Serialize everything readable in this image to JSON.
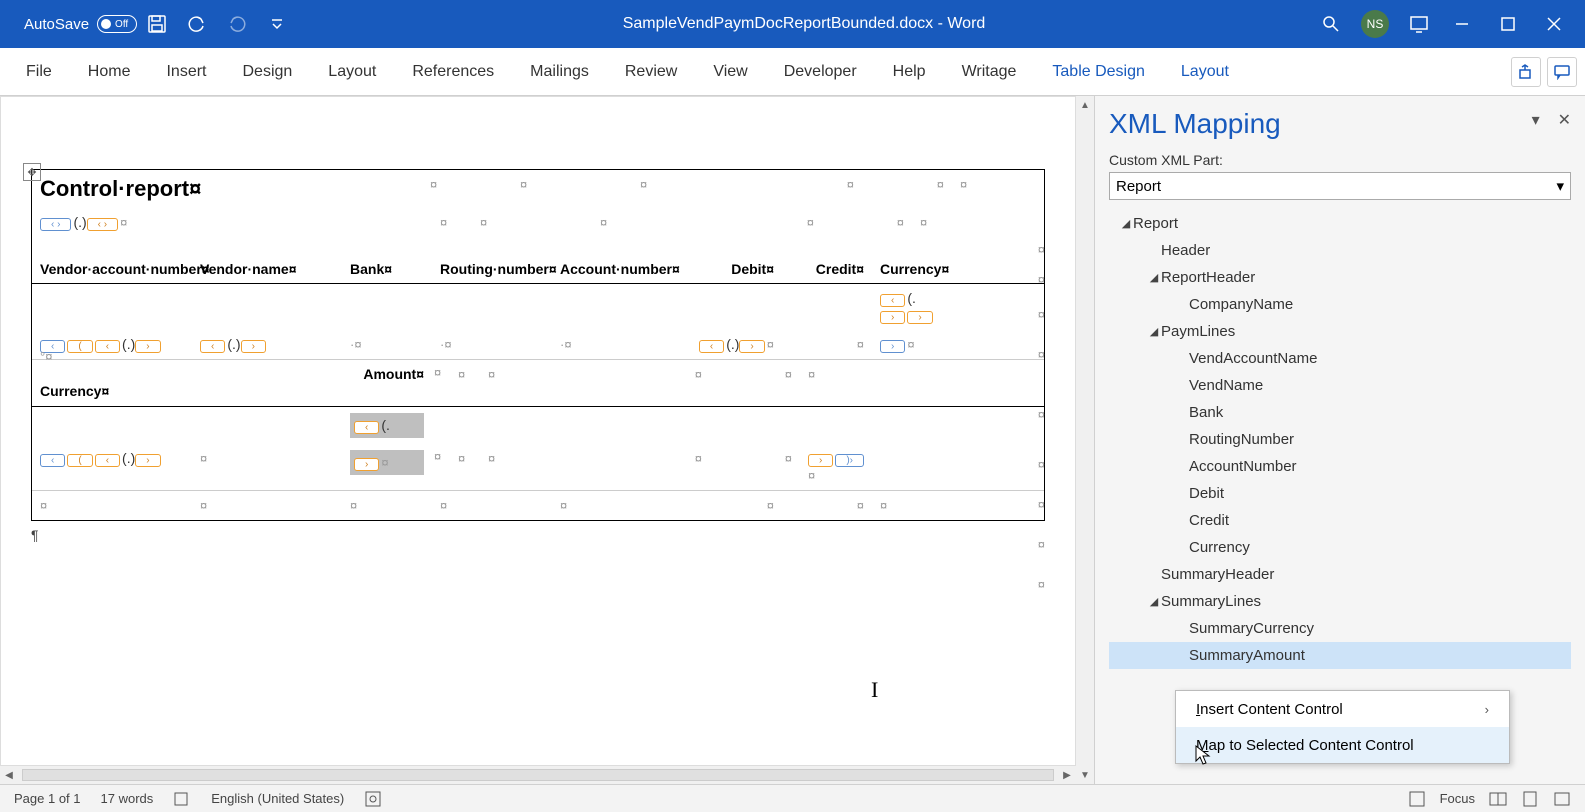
{
  "titlebar": {
    "autosave": "AutoSave",
    "autosave_state": "Off",
    "doc_title": "SampleVendPaymDocReportBounded.docx  -  Word",
    "user_initials": "NS"
  },
  "ribbon": {
    "tabs": [
      "File",
      "Home",
      "Insert",
      "Design",
      "Layout",
      "References",
      "Mailings",
      "Review",
      "View",
      "Developer",
      "Help",
      "Writage"
    ],
    "context_tabs": [
      "Table Design",
      "Layout"
    ]
  },
  "document": {
    "title": "Control·report¤",
    "headers": {
      "vend_acct": "Vendor·account·number¤",
      "vend_name": "Vendor·name¤",
      "bank": "Bank¤",
      "routing": "Routing·number¤",
      "acct_num": "Account·number¤",
      "debit": "Debit¤",
      "credit": "Credit¤",
      "currency": "Currency¤"
    },
    "summary": {
      "currency": "Currency¤",
      "amount": "Amount¤"
    },
    "sq": "¤",
    "para": "¶",
    "dot": "·¤",
    "deg": "°¤"
  },
  "panel": {
    "title": "XML Mapping",
    "label": "Custom XML Part:",
    "select_value": "Report",
    "tree": {
      "report": "Report",
      "header": "Header",
      "report_header": "ReportHeader",
      "company_name": "CompanyName",
      "paym_lines": "PaymLines",
      "vend_account_name": "VendAccountName",
      "vend_name": "VendName",
      "bank": "Bank",
      "routing_number": "RoutingNumber",
      "account_number": "AccountNumber",
      "debit": "Debit",
      "credit": "Credit",
      "currency": "Currency",
      "summary_header": "SummaryHeader",
      "summary_lines": "SummaryLines",
      "summary_currency": "SummaryCurrency",
      "summary_amount": "SummaryAmount"
    }
  },
  "context_menu": {
    "insert": "Insert Content Control",
    "map": "Map to Selected Content Control"
  },
  "statusbar": {
    "page": "Page 1 of 1",
    "words": "17 words",
    "lang": "English (United States)",
    "focus": "Focus"
  }
}
